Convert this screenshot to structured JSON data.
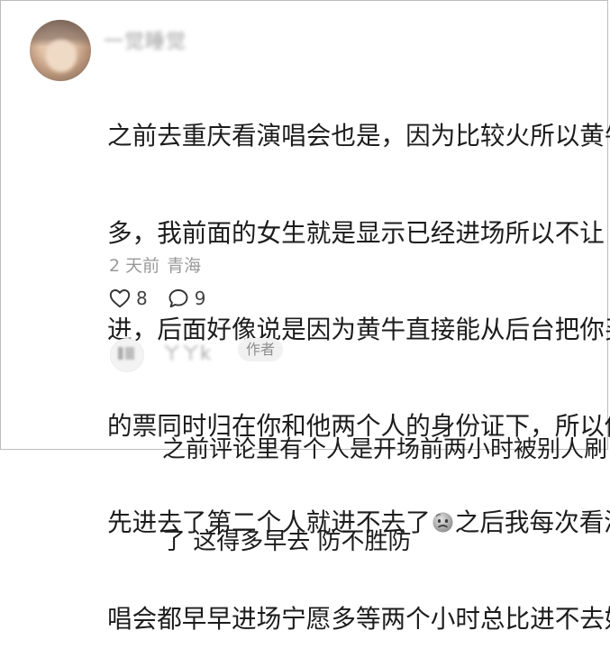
{
  "main_comment": {
    "username": "一觉睡觉",
    "lines": [
      "之前去重庆看演唱会也是，因为比较火所以黄牛",
      "多，我前面的女生就是显示已经进场所以不让",
      "进，后面好像说是因为黄牛直接能从后台把你买",
      "的票同时归在你和他两个人的身份证下，所以他"
    ],
    "line5_before_emoji": "先进去了第二个人就进不去了",
    "emoji": "sad-face-emoji",
    "line5_after_emoji": "之后我每次看演",
    "line6": "唱会都早早进场宁愿多等两个小时总比进不去好",
    "time": "2 天前",
    "location": "青海",
    "likes": "8",
    "replies": "9"
  },
  "reply": {
    "username": "ㄚㄚk",
    "author_tag": "作者",
    "lines": [
      "之前评论里有个人是开场前两小时被别人刷",
      "了 这得多早去 防不胜防"
    ]
  },
  "colors": {
    "text": "#1c1c1c",
    "meta": "#9a9a9a",
    "tag_bg": "#f1f1f1"
  }
}
